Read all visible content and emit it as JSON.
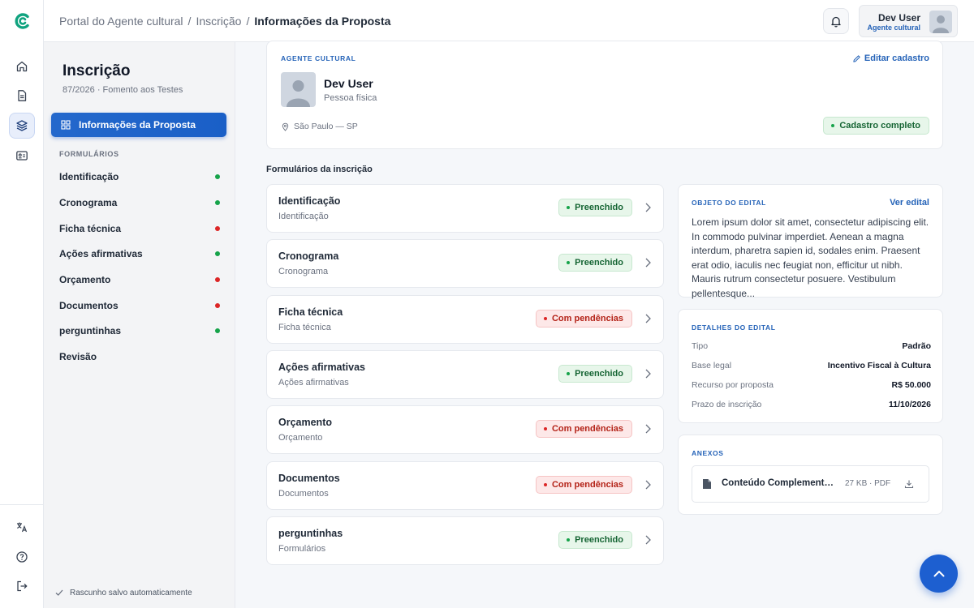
{
  "breadcrumb": [
    "Portal do Agente cultural",
    "Inscrição",
    "Informações da Proposta"
  ],
  "user": {
    "name": "Dev User",
    "role": "Agente cultural"
  },
  "sidebar": {
    "title": "Inscrição",
    "subtitle": "87/2026 · Fomento aos Testes",
    "active_item": "Informações da Proposta",
    "section_label": "FORMULÁRIOS",
    "items": [
      {
        "label": "Identificação",
        "status": "ok"
      },
      {
        "label": "Cronograma",
        "status": "ok"
      },
      {
        "label": "Ficha técnica",
        "status": "pending"
      },
      {
        "label": "Ações afirmativas",
        "status": "ok"
      },
      {
        "label": "Orçamento",
        "status": "pending"
      },
      {
        "label": "Documentos",
        "status": "pending"
      },
      {
        "label": "perguntinhas",
        "status": "ok"
      },
      {
        "label": "Revisão",
        "status": "none"
      }
    ],
    "saved_note": "Rascunho salvo automaticamente"
  },
  "agent": {
    "section_label": "AGENTE CULTURAL",
    "edit_label": "Editar cadastro",
    "name": "Dev User",
    "type": "Pessoa física",
    "location": "São Paulo — SP",
    "status": "Cadastro completo"
  },
  "forms": {
    "title": "Formulários da inscrição",
    "list": [
      {
        "title": "Identificação",
        "subtitle": "Identificação",
        "status": "Preenchido",
        "kind": "ok"
      },
      {
        "title": "Cronograma",
        "subtitle": "Cronograma",
        "status": "Preenchido",
        "kind": "ok"
      },
      {
        "title": "Ficha técnica",
        "subtitle": "Ficha técnica",
        "status": "Com pendências",
        "kind": "bad"
      },
      {
        "title": "Ações afirmativas",
        "subtitle": "Ações afirmativas",
        "status": "Preenchido",
        "kind": "ok"
      },
      {
        "title": "Orçamento",
        "subtitle": "Orçamento",
        "status": "Com pendências",
        "kind": "bad"
      },
      {
        "title": "Documentos",
        "subtitle": "Documentos",
        "status": "Com pendências",
        "kind": "bad"
      },
      {
        "title": "perguntinhas",
        "subtitle": "Formulários",
        "status": "Preenchido",
        "kind": "ok"
      }
    ]
  },
  "edital": {
    "object_label": "OBJETO DO EDITAL",
    "view_label": "Ver edital",
    "object_text": "Lorem ipsum dolor sit amet, consectetur adipiscing elit. In commodo pulvinar imperdiet. Aenean a magna interdum, pharetra sapien id, sodales enim. Praesent erat odio, iaculis nec feugiat non, efficitur ut nibh. Mauris rutrum consectetur posuere. Vestibulum pellentesque...",
    "details_label": "DETALHES DO EDITAL",
    "details": [
      {
        "key": "Tipo",
        "value": "Padrão"
      },
      {
        "key": "Base legal",
        "value": "Incentivo Fiscal à Cultura"
      },
      {
        "key": "Recurso por proposta",
        "value": "R$ 50.000"
      },
      {
        "key": "Prazo de inscrição",
        "value": "11/10/2026"
      }
    ],
    "attachments_label": "ANEXOS",
    "attachment": {
      "name": "Conteúdo Complementar do Edital",
      "meta": "27 KB · PDF"
    }
  },
  "colors": {
    "accent": "#1d5fd0",
    "ok": "#16a34a",
    "pending": "#dc2626"
  }
}
